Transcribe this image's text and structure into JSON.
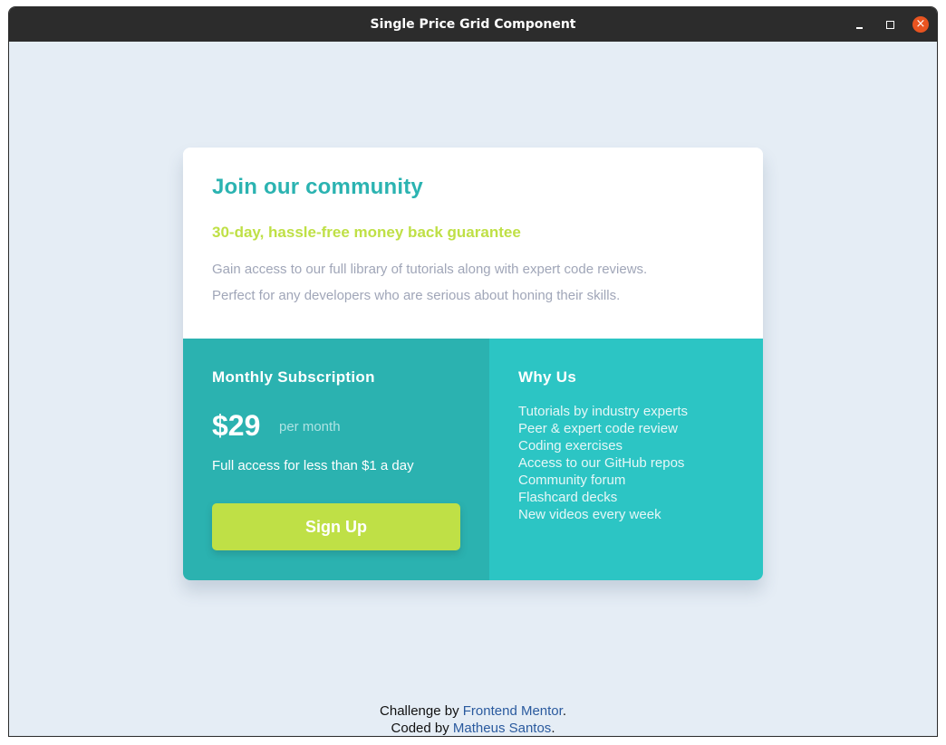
{
  "window": {
    "title": "Single Price Grid Component",
    "controls": {
      "minimize": "–",
      "maximize": "□",
      "close": "×"
    }
  },
  "card": {
    "top": {
      "heading": "Join our community",
      "subheading": "30-day, hassle-free money back guarantee",
      "description_line1": "Gain access to our full library of tutorials along with expert code reviews.",
      "description_line2": "Perfect for any developers who are serious about honing their skills."
    },
    "subscription": {
      "heading": "Monthly Subscription",
      "price": "$29",
      "period": "per month",
      "note": "Full access for less than $1 a day",
      "button_label": "Sign Up"
    },
    "why_us": {
      "heading": "Why Us",
      "items": [
        "Tutorials by industry experts",
        "Peer & expert code review",
        "Coding exercises",
        "Access to our GitHub repos",
        "Community forum",
        "Flashcard decks",
        "New videos every week"
      ]
    }
  },
  "attribution": {
    "challenge_prefix": "Challenge by ",
    "challenge_link": "Frontend Mentor",
    "challenge_suffix": ".",
    "coded_prefix": "Coded by ",
    "coded_link": "Matheus Santos",
    "coded_suffix": "."
  },
  "colors": {
    "accent_cyan": "#2bb3b1",
    "accent_lime": "#bfe046",
    "panel_dark": "#2bb2b0",
    "panel_light": "#2cc5c4",
    "background": "#e5edf5",
    "close_button": "#e95420"
  }
}
